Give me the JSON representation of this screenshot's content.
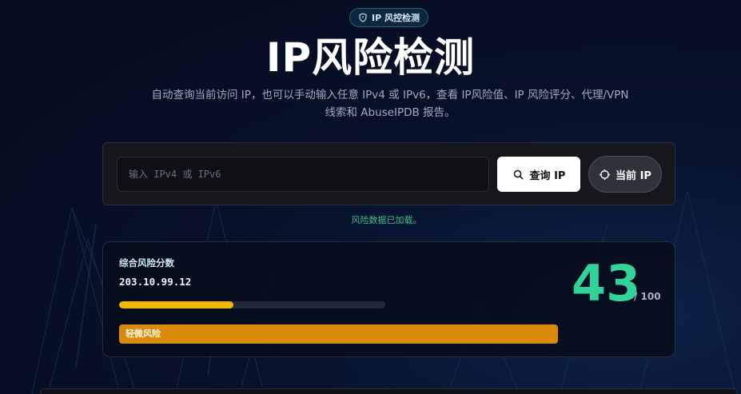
{
  "badge": {
    "label": "IP 风控检测",
    "icon": "shield-icon"
  },
  "hero": {
    "title": "IP风险检测",
    "subtitle": "自动查询当前访问 IP，也可以手动输入任意 IPv4 或 IPv6，查看 IP风险值、IP 风险评分、代理/VPN 线索和 AbuseIPDB 报告。"
  },
  "search": {
    "placeholder": "输入 IPv4 或 IPv6",
    "value": "",
    "query_label": "查询 IP",
    "query_icon": "search-icon",
    "current_label": "当前 IP",
    "current_icon": "crosshair-icon"
  },
  "status": {
    "message": "风险数据已加载。",
    "color": "#3ec08d"
  },
  "score": {
    "label": "综合风险分数",
    "ip": "203.10.99.12",
    "value": "43",
    "max": "/ 100",
    "progress_percent": 43,
    "risk_label": "轻微风险",
    "colors": {
      "score": "#31d39b",
      "bar": "#f2b705",
      "risk": "#d98a0b"
    }
  }
}
